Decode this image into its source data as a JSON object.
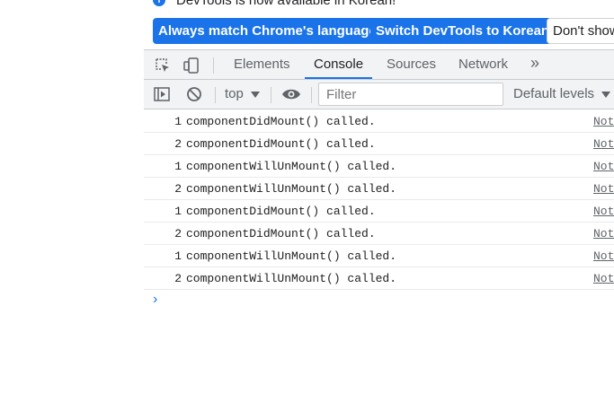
{
  "infobar": {
    "message": "DevTools is now available in Korean!",
    "buttons": [
      "Always match Chrome's language",
      "Switch DevTools to Korean",
      "Don't show"
    ]
  },
  "tabs": [
    "Elements",
    "Console",
    "Sources",
    "Network"
  ],
  "active_tab": "Console",
  "more_tabs": "»",
  "console_toolbar": {
    "context": "top",
    "filter_placeholder": "Filter",
    "levels": "Default levels"
  },
  "messages": [
    {
      "count": "1",
      "text": "componentDidMount() called.",
      "source": "Not"
    },
    {
      "count": "2",
      "text": "componentDidMount() called.",
      "source": "Not"
    },
    {
      "count": "1",
      "text": "componentWillUnMount() called.",
      "source": "Not"
    },
    {
      "count": "2",
      "text": "componentWillUnMount() called.",
      "source": "Not"
    },
    {
      "count": "1",
      "text": "componentDidMount() called.",
      "source": "Not"
    },
    {
      "count": "2",
      "text": "componentDidMount() called.",
      "source": "Not"
    },
    {
      "count": "1",
      "text": "componentWillUnMount() called.",
      "source": "Not"
    },
    {
      "count": "2",
      "text": "componentWillUnMount() called.",
      "source": "Not"
    }
  ],
  "prompt": "›",
  "colors": {
    "accent": "#1a73e8",
    "toolbar_bg": "#f1f3f4",
    "border": "#cacdd1"
  }
}
